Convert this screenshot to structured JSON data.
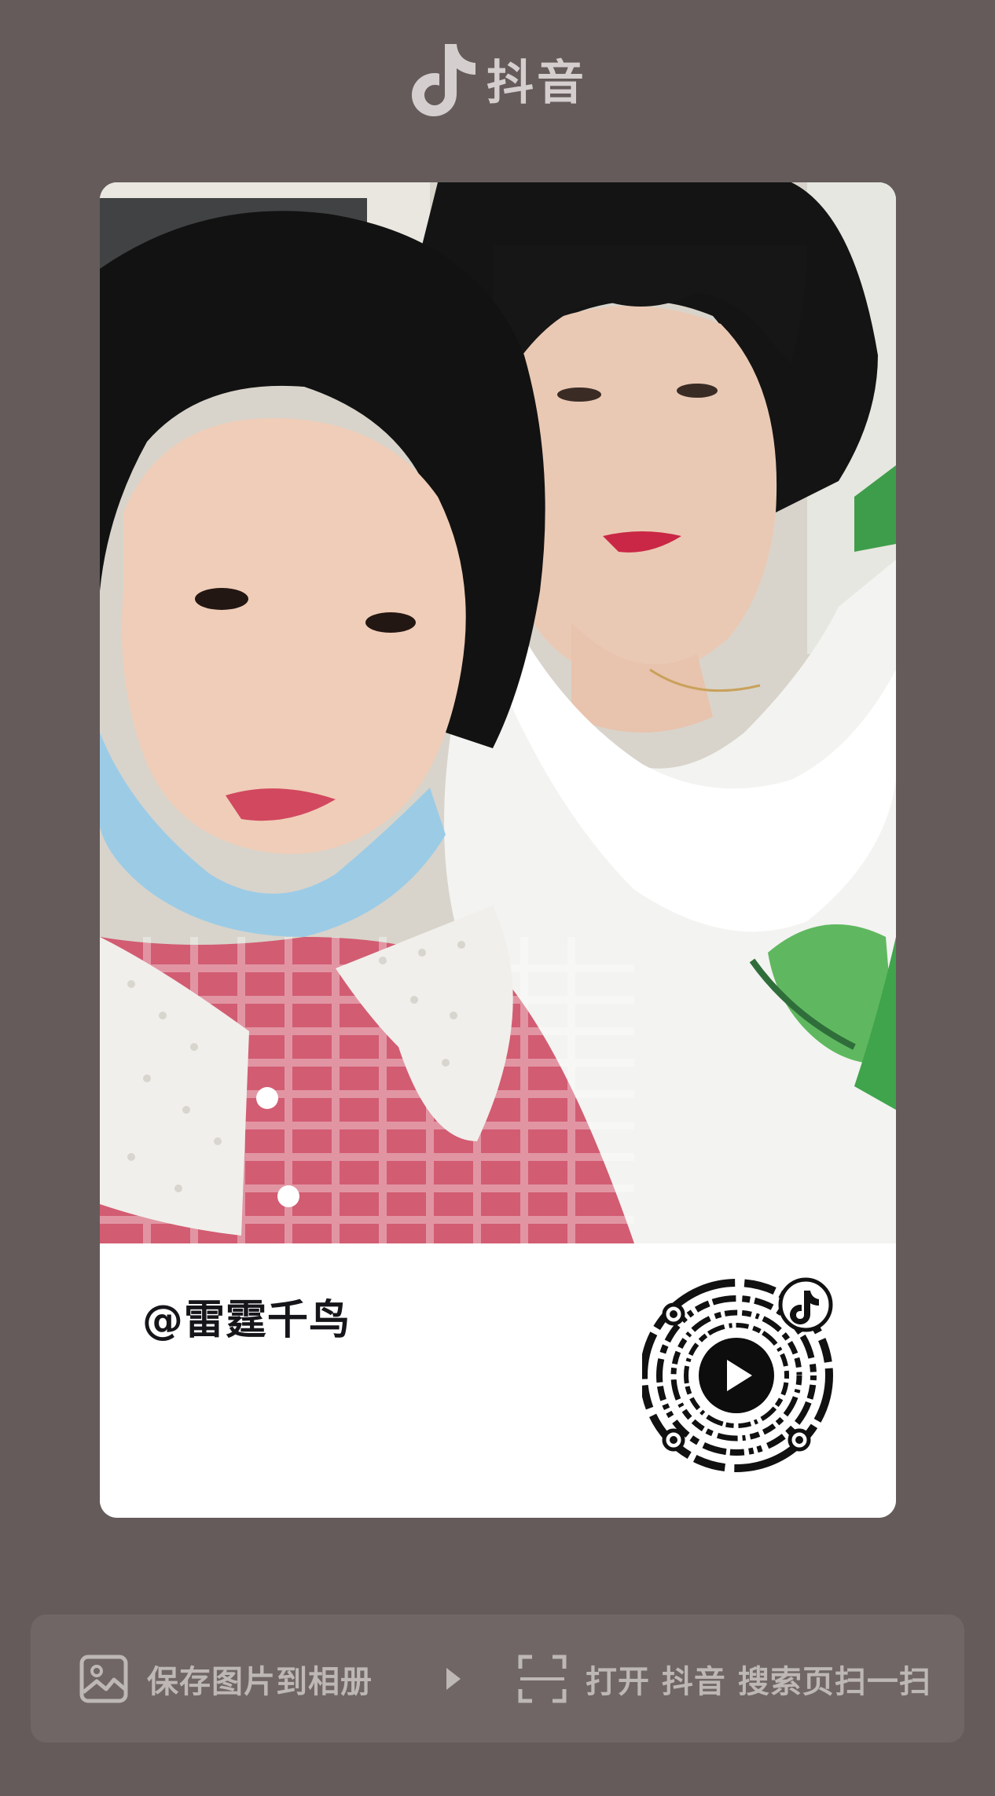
{
  "brand": {
    "name": "抖音",
    "icon": "tiktok-note-icon"
  },
  "card": {
    "username": "@雷霆千鸟",
    "qrcode_icon": "douyin-qr-code",
    "qrcode_center_icon": "play-icon"
  },
  "actions": {
    "save_label": "保存图片到相册",
    "save_icon": "image-icon",
    "arrow_icon": "arrow-right-icon",
    "scan_label": "打开 抖音 搜索页扫一扫",
    "scan_icon": "scan-icon"
  },
  "colors": {
    "background": "#655b5a",
    "action_bar": "#6f6665",
    "card": "#ffffff",
    "username_text": "#16161a",
    "action_text": "#bdb7b6"
  }
}
